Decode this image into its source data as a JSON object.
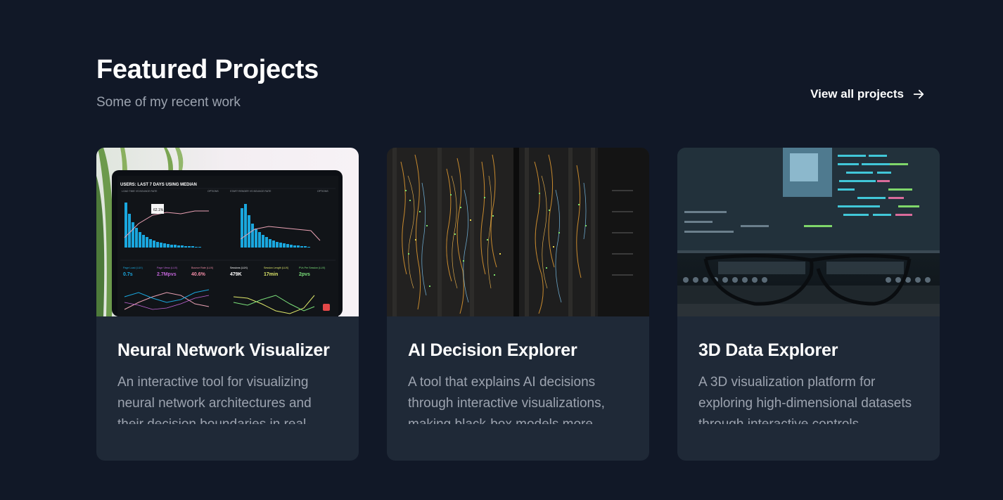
{
  "header": {
    "title": "Featured Projects",
    "subtitle": "Some of my recent work",
    "view_all_label": "View all projects",
    "view_all_icon": "arrow-right-icon"
  },
  "projects": [
    {
      "title": "Neural Network Visualizer",
      "description": "An interactive tool for visualizing neural network architectures and their decision boundaries in real-time.",
      "image": "analytics-dashboard-laptop",
      "image_text": {
        "header": "USERS: LAST 7 DAYS USING MEDIAN",
        "panel_1": "LOAD TIME VS BOUNCE RATE",
        "panel_2": "START RENDER VS BOUNCE RATE",
        "options": "OPTIONS",
        "tooltip": "62.1%",
        "metric_1_label": "Page Load (LUX)",
        "metric_1_value": "0.7s",
        "metric_2_label": "Page Views (LUX)",
        "metric_2_value": "2.7Mpvs",
        "metric_3_label": "Bounce Rate (LUX)",
        "metric_3_value": "40.6%",
        "metric_4_label": "Sessions (LUX)",
        "metric_4_value": "479K",
        "metric_5_label": "Session Length (LUX)",
        "metric_5_value": "17min",
        "metric_6_label": "PVs Per Session (LUX)",
        "metric_6_value": "2pvs"
      }
    },
    {
      "title": "AI Decision Explorer",
      "description": "A tool that explains AI decisions through interactive visualizations, making black-box models more transparent.",
      "image": "server-rack-cables"
    },
    {
      "title": "3D Data Explorer",
      "description": "A 3D visualization platform for exploring high-dimensional datasets through interactive controls.",
      "image": "glasses-code-screen"
    }
  ],
  "colors": {
    "background": "#111827",
    "card": "#1f2937",
    "muted_text": "#9ca3af",
    "accent_cyan": "#22b5e5"
  }
}
